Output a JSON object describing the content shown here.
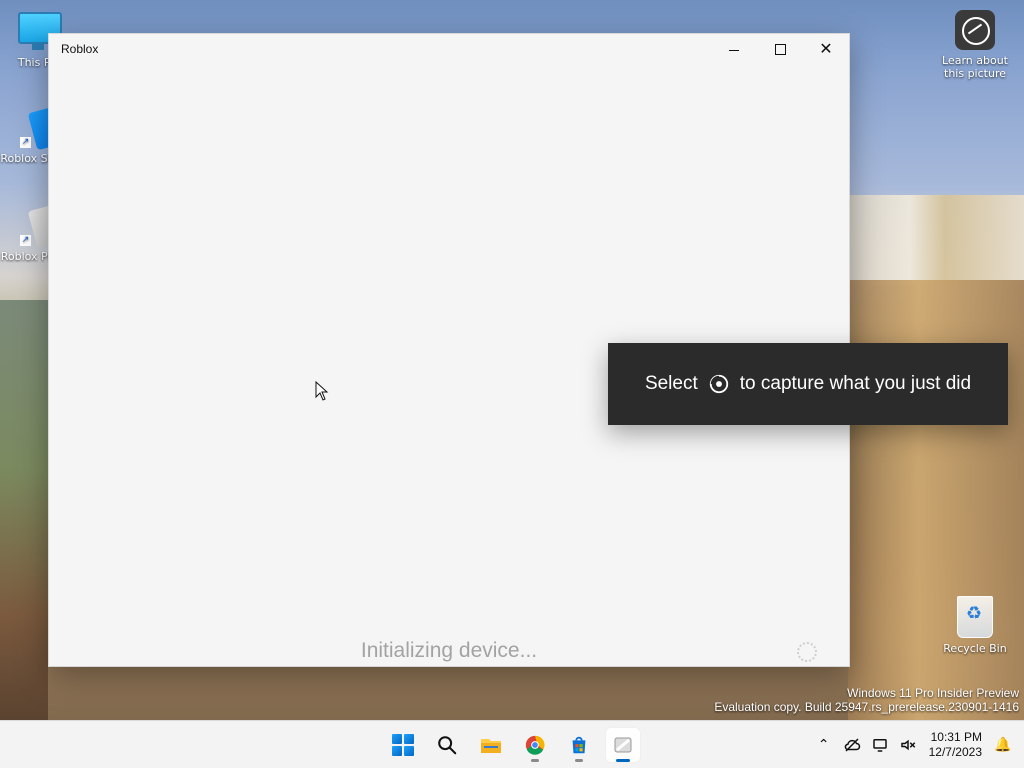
{
  "desktop": {
    "icons": [
      {
        "label": "This PC",
        "icon": "monitor-icon"
      },
      {
        "label": "Roblox Studio",
        "icon": "roblox-studio-icon"
      },
      {
        "label": "Roblox Player",
        "icon": "roblox-player-icon"
      }
    ],
    "learn_picture": {
      "label": "Learn about this picture",
      "icon": "camera-info-icon"
    },
    "recycle_bin": {
      "label": "Recycle Bin",
      "icon": "recycle-bin-icon"
    }
  },
  "window": {
    "title": "Roblox",
    "controls": {
      "minimize_icon": "minimize-icon",
      "maximize_icon": "maximize-icon",
      "close_icon": "close-icon"
    },
    "status_text": "Initializing device...",
    "spinner_icon": "spinner-icon"
  },
  "cursor": {
    "icon": "mouse-pointer-icon"
  },
  "capture_toast": {
    "text_before": "Select",
    "icon": "capture-record-icon",
    "text_after": "to capture what you just did"
  },
  "watermark": {
    "line1": "Windows 11 Pro Insider Preview",
    "line2": "Evaluation copy. Build 25947.rs_prerelease.230901-1416"
  },
  "taskbar": {
    "apps": [
      {
        "name": "Start",
        "icon": "windows-start-icon"
      },
      {
        "name": "Search",
        "icon": "search-icon"
      },
      {
        "name": "File Explorer",
        "icon": "folder-icon"
      },
      {
        "name": "Google Chrome",
        "icon": "chrome-icon"
      },
      {
        "name": "Microsoft Store",
        "icon": "store-icon"
      },
      {
        "name": "Roblox",
        "icon": "roblox-taskbar-icon"
      }
    ],
    "tray": {
      "icons": [
        "chevron-up-icon",
        "no-network-icon",
        "display-icon",
        "volume-mute-icon"
      ],
      "time": "10:31 PM",
      "date": "12/7/2023",
      "notifications_icon": "bell-icon"
    }
  },
  "colors": {
    "accent": "#0067c0",
    "toast_bg": "#2b2b2b",
    "window_bg": "#f5f5f5",
    "status_text": "#a3a3a3"
  }
}
